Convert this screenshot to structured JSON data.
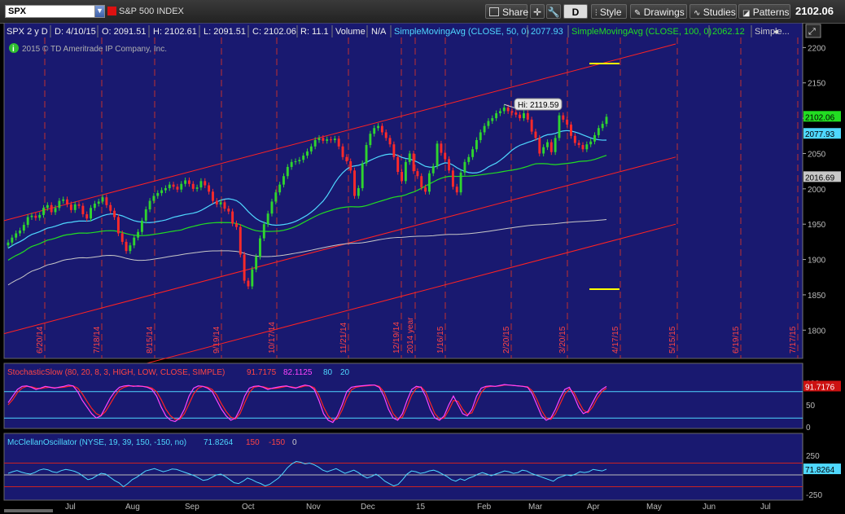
{
  "toolbar": {
    "symbol": "SPX",
    "symbol_name": "S&P 500 INDEX",
    "share": "Share",
    "period_button": "D",
    "style": "Style",
    "drawings": "Drawings",
    "studies": "Studies",
    "patterns": "Patterns",
    "last_price": "2102.06"
  },
  "info_bar": {
    "period": "SPX 2 y D",
    "date": "D: 4/10/15",
    "open": "O: 2091.51",
    "high": "H: 2102.61",
    "low": "L: 2091.51",
    "close": "C: 2102.06",
    "range": "R: 11.1",
    "volume_label": "Volume",
    "volume_value": "N/A",
    "sma50_label": "SimpleMovingAvg (CLOSE, 50, 0)",
    "sma50_value": "2077.93",
    "sma100_label": "SimpleMovingAvg (CLOSE, 100, 0)",
    "sma100_value": "2062.12",
    "more": "Simple..."
  },
  "copyright": "2015 © TD Ameritrade IP Company, Inc.",
  "hi_label": "Hi: 2119.59",
  "colors": {
    "background": "#191970",
    "candle_up": "#2fd42f",
    "candle_down": "#ff2a2a",
    "sma50": "#4fd8ff",
    "sma100": "#22dd22",
    "sma200": "#c8c8c8",
    "channel": "#ff2222",
    "marker": "#ffff00",
    "stoch_k": "#ff44ff",
    "stoch_d": "#ff2222",
    "mcclellan": "#4fd8ff"
  },
  "chart_data": [
    {
      "type": "candlestick",
      "ylim": [
        1760,
        2235
      ],
      "yticks": [
        1800,
        1850,
        1900,
        1950,
        2000,
        2050,
        2100,
        2150,
        2200
      ],
      "price_labels": [
        "2102.06",
        "2077.93",
        "2016.69"
      ],
      "vertical_dates": [
        "6/20/14",
        "7/18/14",
        "8/15/14",
        "9/19/14",
        "10/17/14",
        "11/21/14",
        "12/19/14",
        "2014 year",
        "1/16/15",
        "2/20/15",
        "3/20/15",
        "4/17/15",
        "5/15/15",
        "6/19/15",
        "7/17/15"
      ],
      "x_month_labels": [
        "Jul",
        "Aug",
        "Sep",
        "Oct",
        "Nov",
        "Dec",
        "15",
        "Feb",
        "Mar",
        "Apr",
        "May",
        "Jun",
        "Jul"
      ],
      "closes": [
        1924,
        1931,
        1937,
        1941,
        1949,
        1960,
        1962,
        1959,
        1963,
        1973,
        1977,
        1967,
        1973,
        1983,
        1985,
        1978,
        1970,
        1978,
        1976,
        1964,
        1958,
        1973,
        1979,
        1982,
        1988,
        1977,
        1969,
        1960,
        1937,
        1925,
        1912,
        1920,
        1931,
        1939,
        1955,
        1971,
        1983,
        1990,
        1994,
        1998,
        2001,
        2006,
        2003,
        1999,
        2007,
        2012,
        2007,
        2000,
        2002,
        2011,
        2005,
        1996,
        1983,
        1978,
        1981,
        1972,
        1968,
        1951,
        1946,
        1907,
        1870,
        1862,
        1886,
        1904,
        1930,
        1950,
        1965,
        1982,
        1995,
        2006,
        2018,
        2031,
        2038,
        2039,
        2041,
        2047,
        2053,
        2060,
        2069,
        2072,
        2068,
        2070,
        2069,
        2071,
        2060,
        2045,
        2039,
        2026,
        1990,
        2001,
        2036,
        2062,
        2078,
        2086,
        2089,
        2080,
        2072,
        2063,
        2045,
        2024,
        2011,
        2038,
        2050,
        2025,
        2018,
        2002,
        1996,
        2022,
        2032,
        2064,
        2051,
        2042,
        2026,
        2003,
        1995,
        2023,
        2038,
        2045,
        2056,
        2069,
        2080,
        2089,
        2096,
        2100,
        2107,
        2110,
        2115,
        2110,
        2108,
        2105,
        2100,
        2107,
        2098,
        2081,
        2072,
        2050,
        2059,
        2066,
        2052,
        2072,
        2104,
        2098,
        2091,
        2075,
        2065,
        2062,
        2056,
        2063,
        2067,
        2076,
        2086,
        2092,
        2102
      ],
      "series": [
        {
          "name": "SimpleMovingAvg (CLOSE, 50, 0)",
          "last": 2077.93
        },
        {
          "name": "SimpleMovingAvg (CLOSE, 100, 0)",
          "last": 2062.12
        }
      ],
      "hi": 2119.59
    },
    {
      "type": "line",
      "title": "StochasticSlow (80, 20, 8, 3, HIGH, LOW, CLOSE, SIMPLE)",
      "values_label": [
        "91.7175",
        "82.1125",
        "80",
        "20"
      ],
      "last_label": "91.7176",
      "ylim": [
        0,
        100
      ],
      "yticks": [
        0,
        50,
        100
      ],
      "levels": [
        80,
        20
      ],
      "k": [
        55,
        70,
        85,
        92,
        93,
        90,
        85,
        88,
        92,
        90,
        88,
        90,
        92,
        95,
        93,
        80,
        60,
        45,
        30,
        20,
        25,
        45,
        65,
        80,
        90,
        93,
        94,
        92,
        93,
        92,
        90,
        85,
        70,
        45,
        25,
        15,
        12,
        20,
        40,
        70,
        88,
        93,
        92,
        88,
        80,
        60,
        40,
        25,
        15,
        20,
        40,
        70,
        88,
        92,
        93,
        90,
        85,
        88,
        90,
        92,
        93,
        90,
        88,
        92,
        95,
        93,
        85,
        60,
        30,
        15,
        10,
        25,
        50,
        80,
        90,
        92,
        93,
        94,
        95,
        95,
        90,
        70,
        40,
        20,
        15,
        30,
        60,
        85,
        92,
        90,
        70,
        40,
        20,
        15,
        25,
        50,
        70,
        50,
        30,
        25,
        40,
        70,
        88,
        92,
        93,
        92,
        94,
        96,
        95,
        94,
        93,
        92,
        90,
        75,
        50,
        25,
        15,
        20,
        40,
        65,
        85,
        90,
        70,
        45,
        30,
        35,
        55,
        75,
        85,
        92
      ],
      "d": [
        50,
        62,
        78,
        88,
        92,
        91,
        88,
        87,
        89,
        90,
        89,
        89,
        90,
        92,
        93,
        88,
        75,
        58,
        42,
        30,
        25,
        35,
        52,
        70,
        84,
        90,
        93,
        93,
        92,
        92,
        91,
        88,
        80,
        62,
        40,
        25,
        17,
        17,
        30,
        52,
        75,
        88,
        92,
        90,
        85,
        72,
        52,
        35,
        22,
        18,
        30,
        55,
        78,
        90,
        92,
        91,
        88,
        87,
        88,
        90,
        92,
        91,
        89,
        90,
        93,
        93,
        89,
        72,
        45,
        25,
        15,
        18,
        38,
        65,
        84,
        90,
        92,
        93,
        94,
        95,
        92,
        80,
        55,
        30,
        18,
        22,
        45,
        72,
        88,
        91,
        80,
        55,
        30,
        18,
        20,
        38,
        60,
        58,
        40,
        28,
        32,
        55,
        78,
        90,
        92,
        92,
        93,
        95,
        95,
        94,
        93,
        92,
        91,
        82,
        62,
        37,
        20,
        17,
        30,
        52,
        75,
        86,
        78,
        57,
        38,
        32,
        45,
        65,
        80,
        88
      ]
    },
    {
      "type": "line",
      "title": "McClellanOscillator (NYSE, 19, 39, 150, -150, no)",
      "values_label": [
        "71.8264",
        "150",
        "-150",
        "0"
      ],
      "last_label": "71.8264",
      "ylim": [
        -300,
        300
      ],
      "yticks": [
        250,
        0,
        -250
      ],
      "levels": [
        150,
        0,
        -150
      ],
      "values": [
        20,
        40,
        55,
        35,
        20,
        10,
        30,
        60,
        75,
        65,
        40,
        30,
        55,
        70,
        60,
        45,
        20,
        -20,
        -60,
        -45,
        -10,
        20,
        10,
        -30,
        -70,
        -100,
        -150,
        -110,
        -60,
        -30,
        10,
        50,
        65,
        80,
        60,
        40,
        55,
        75,
        70,
        50,
        30,
        10,
        -10,
        -40,
        -70,
        -60,
        -30,
        0,
        10,
        -20,
        -60,
        -100,
        -110,
        -80,
        -40,
        -60,
        -90,
        -110,
        -140,
        -120,
        -80,
        -40,
        20,
        90,
        140,
        170,
        160,
        140,
        150,
        130,
        100,
        60,
        40,
        60,
        80,
        50,
        20,
        40,
        60,
        30,
        -10,
        -40,
        -20,
        10,
        -30,
        -80,
        -110,
        -140,
        -120,
        -60,
        10,
        50,
        40,
        20,
        30,
        50,
        60,
        40,
        10,
        -20,
        -60,
        -80,
        -50,
        -70,
        -40,
        -20,
        10,
        30,
        10,
        -10,
        10,
        30,
        50,
        40,
        20,
        30,
        60,
        50,
        20,
        0,
        -20,
        -40,
        -60,
        -80,
        -40,
        -20,
        0,
        -10,
        10,
        40,
        30,
        40,
        70,
        60,
        50,
        72
      ]
    }
  ]
}
